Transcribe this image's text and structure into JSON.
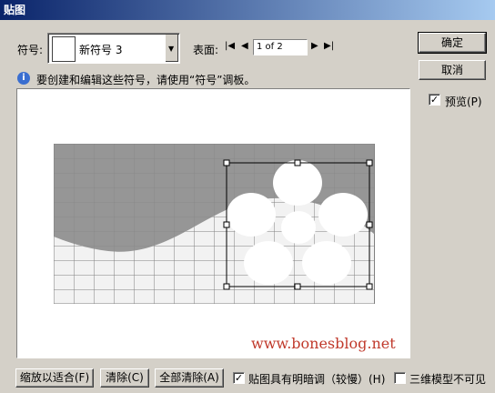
{
  "window": {
    "title": "贴图"
  },
  "symbol": {
    "label": "符号:",
    "value": "新符号 3"
  },
  "surface": {
    "label": "表面:",
    "page": "1 of 2"
  },
  "info": {
    "text": "要创建和编辑这些符号，请使用“符号”调板。"
  },
  "buttons": {
    "ok": "确定",
    "cancel": "取消"
  },
  "preview_check": {
    "label": "预览(P)",
    "checked": true
  },
  "bottom": {
    "fit": "缩放以适合(F)",
    "clear": "清除(C)",
    "clear_all": "全部清除(A)",
    "shade_label": "贴图具有明暗调（较慢）(H)",
    "shade_checked": true,
    "hide_label": "三维模型不可见",
    "hide_checked": false
  },
  "watermark": "www.bonesblog.net",
  "icons": [
    "info-icon",
    "first-page-icon",
    "prev-page-icon",
    "next-page-icon",
    "last-page-icon",
    "dropdown-arrow-icon",
    "checkmark-icon"
  ],
  "colors": {
    "titlebar": "#0a246a",
    "dialog": "#d4d0c8",
    "watermark": "#c0392b"
  }
}
